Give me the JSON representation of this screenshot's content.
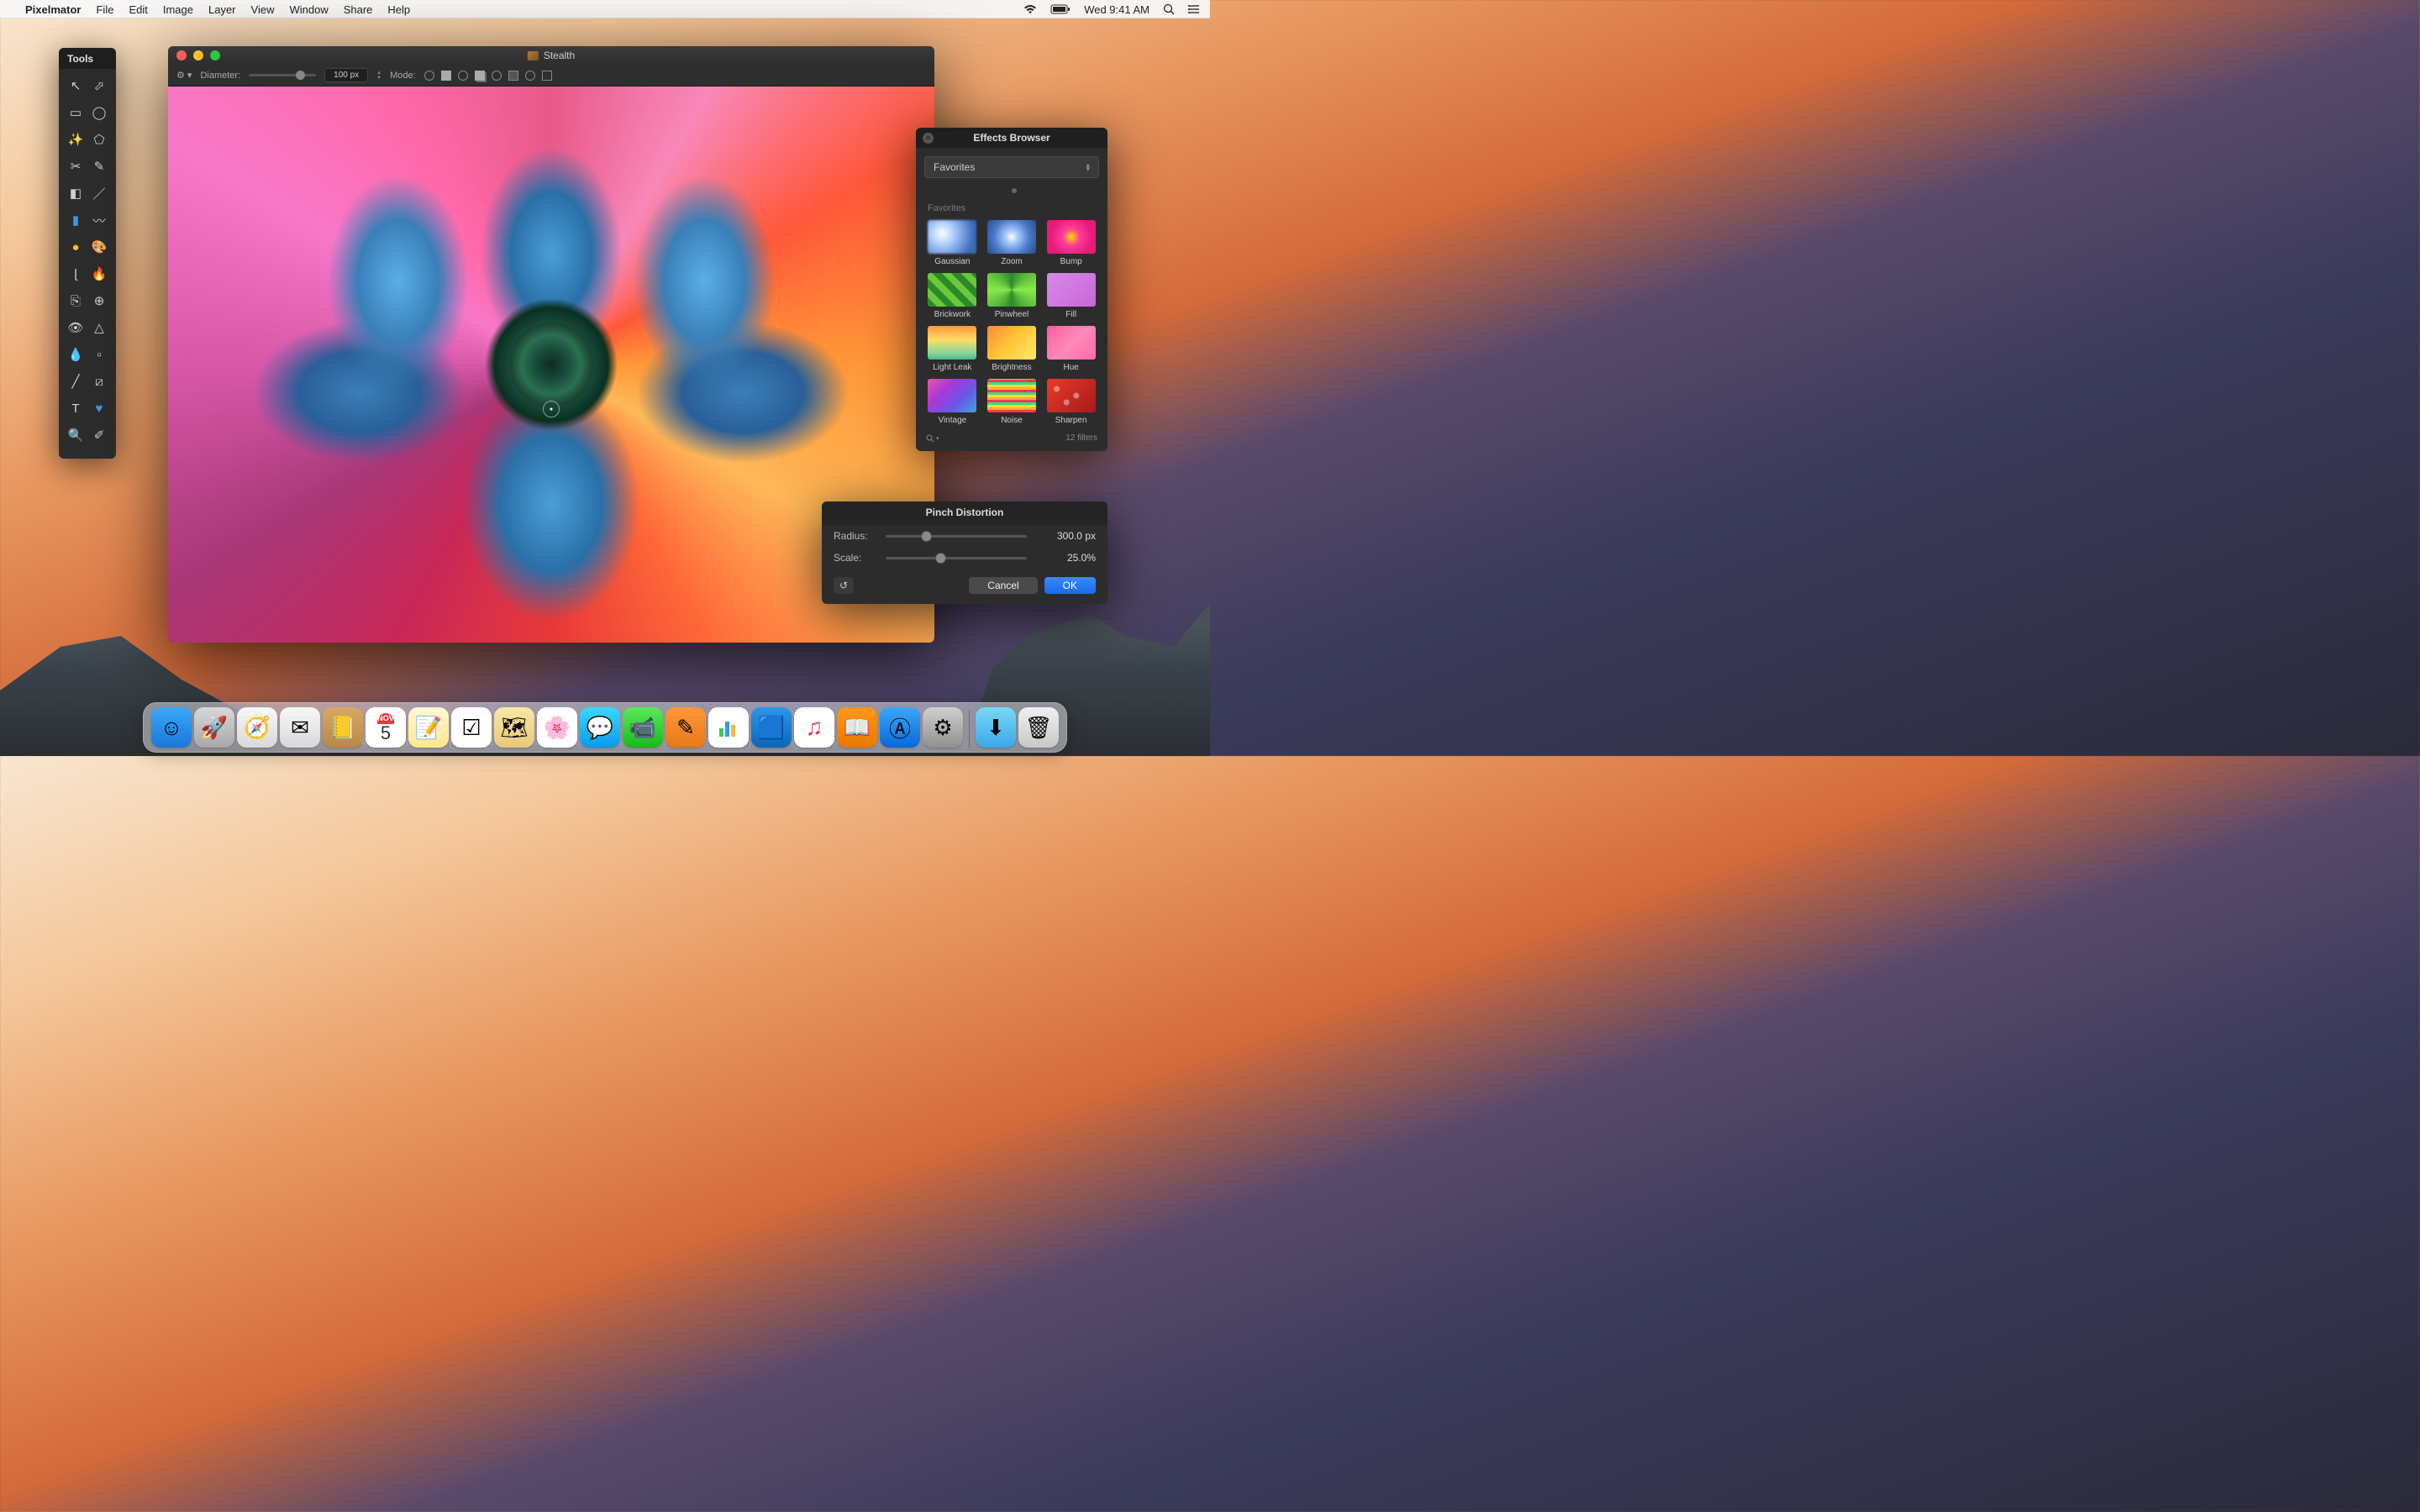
{
  "menubar": {
    "app": "Pixelmator",
    "items": [
      "File",
      "Edit",
      "Image",
      "Layer",
      "View",
      "Window",
      "Share",
      "Help"
    ],
    "clock": "Wed 9:41 AM"
  },
  "tools_panel": {
    "title": "Tools",
    "tools": [
      "move-tool",
      "selection-tool",
      "marquee-tool",
      "lasso-tool",
      "magic-wand-tool",
      "polygonal-lasso-tool",
      "crop-tool",
      "pen-tool",
      "eraser-tool",
      "paint-tool",
      "gradient-tool",
      "smudge-tool",
      "sponge-tool",
      "color-picker-tool",
      "brush-tool",
      "burn-tool",
      "clone-tool",
      "heal-tool",
      "red-eye-tool",
      "sharpen-tool",
      "blur-tool",
      "pixel-tool",
      "line-tool",
      "slice-tool",
      "type-tool",
      "shape-tool",
      "zoom-tool",
      "eyedropper-tool"
    ]
  },
  "document": {
    "title": "Stealth",
    "options": {
      "diameter_label": "Diameter:",
      "diameter_value": "100 px",
      "mode_label": "Mode:"
    }
  },
  "effects": {
    "title": "Effects Browser",
    "dropdown": "Favorites",
    "section": "Favorites",
    "items": [
      {
        "label": "Gaussian",
        "thumb": "th-gaussian"
      },
      {
        "label": "Zoom",
        "thumb": "th-zoom"
      },
      {
        "label": "Bump",
        "thumb": "th-bump"
      },
      {
        "label": "Brickwork",
        "thumb": "th-brickwork"
      },
      {
        "label": "Pinwheel",
        "thumb": "th-pinwheel"
      },
      {
        "label": "Fill",
        "thumb": "th-fill"
      },
      {
        "label": "Light Leak",
        "thumb": "th-lightleak"
      },
      {
        "label": "Brightness",
        "thumb": "th-brightness"
      },
      {
        "label": "Hue",
        "thumb": "th-hue"
      },
      {
        "label": "Vintage",
        "thumb": "th-vintage"
      },
      {
        "label": "Noise",
        "thumb": "th-noise"
      },
      {
        "label": "Sharpen",
        "thumb": "th-sharpen"
      }
    ],
    "count": "12 filters"
  },
  "pinch": {
    "title": "Pinch Distortion",
    "radius_label": "Radius:",
    "radius_value": "300.0 px",
    "radius_pct": 25,
    "scale_label": "Scale:",
    "scale_value": "25.0%",
    "scale_pct": 35,
    "cancel": "Cancel",
    "ok": "OK"
  },
  "dock": {
    "apps": [
      {
        "name": "finder",
        "class": "di-finder",
        "glyph": "☺"
      },
      {
        "name": "launchpad",
        "class": "di-launchpad",
        "glyph": "🚀"
      },
      {
        "name": "safari",
        "class": "di-safari",
        "glyph": "🧭"
      },
      {
        "name": "mail",
        "class": "di-mail",
        "glyph": "✉"
      },
      {
        "name": "contacts",
        "class": "di-contacts",
        "glyph": "📒"
      },
      {
        "name": "calendar",
        "class": "di-cal",
        "glyph": ""
      },
      {
        "name": "notes",
        "class": "di-notes",
        "glyph": "📝"
      },
      {
        "name": "reminders",
        "class": "di-reminders",
        "glyph": "☑"
      },
      {
        "name": "maps",
        "class": "di-maps",
        "glyph": "🗺"
      },
      {
        "name": "photos",
        "class": "di-photos",
        "glyph": "🌸"
      },
      {
        "name": "messages",
        "class": "di-messages",
        "glyph": "💬"
      },
      {
        "name": "facetime",
        "class": "di-facetime",
        "glyph": "📹"
      },
      {
        "name": "pages",
        "class": "di-pages",
        "glyph": "✎"
      },
      {
        "name": "numbers",
        "class": "di-numbers",
        "glyph": "📊"
      },
      {
        "name": "keynote",
        "class": "di-keynote",
        "glyph": "🟦"
      },
      {
        "name": "itunes",
        "class": "di-itunes",
        "glyph": "♫"
      },
      {
        "name": "ibooks",
        "class": "di-ibooks",
        "glyph": "📖"
      },
      {
        "name": "appstore",
        "class": "di-appstore",
        "glyph": "Ⓐ"
      },
      {
        "name": "sysprefs",
        "class": "di-sysprefs",
        "glyph": "⚙"
      }
    ],
    "right": [
      {
        "name": "downloads",
        "class": "di-downloads",
        "glyph": "⬇"
      },
      {
        "name": "trash",
        "class": "di-trash",
        "glyph": "🗑"
      }
    ],
    "cal_month": "NOV",
    "cal_day": "5"
  }
}
